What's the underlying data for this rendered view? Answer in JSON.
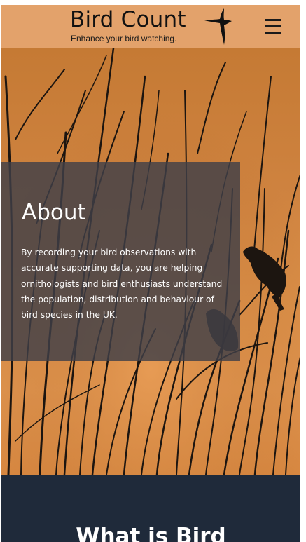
{
  "header": {
    "title": "Bird Count",
    "tagline": "Enhance your bird watching.",
    "menu_icon": "hamburger-menu-icon",
    "background": "#e3a26b"
  },
  "hero": {
    "image": "bird-silhouettes-on-branches-at-sunset",
    "about": {
      "heading": "About",
      "body": "By recording your bird observations with accurate supporting data, you are helping ornithologists and bird enthusiasts understand the population, distribution and behaviour of bird species in the UK."
    }
  },
  "next_section": {
    "heading": "What is Bird",
    "background": "#1f2a3a"
  }
}
